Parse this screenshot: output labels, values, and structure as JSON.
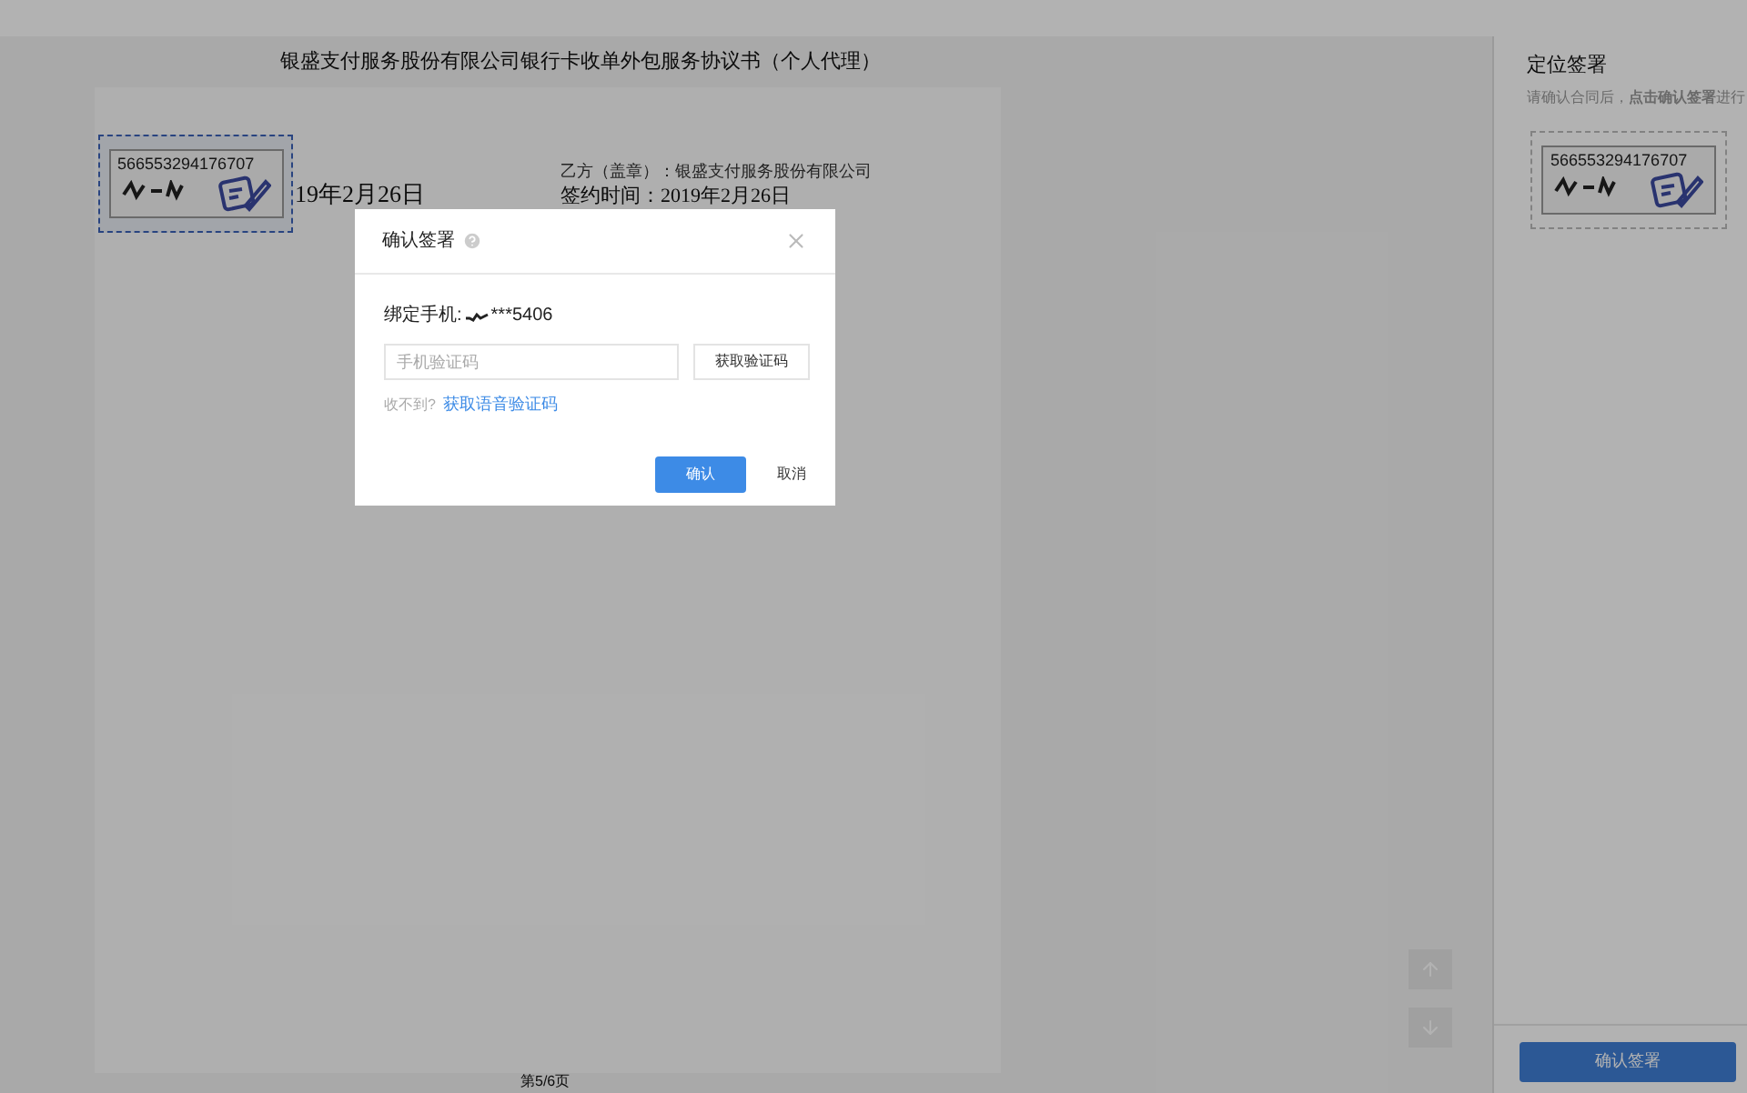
{
  "document": {
    "title": "银盛支付服务股份有限公司银行卡收单外包服务协议书（个人代理）",
    "left_date": "19年2月26日",
    "party_b": "乙方（盖章）：银盛支付服务股份有限公司",
    "sign_time": "签约时间：2019年2月26日",
    "stamp": {
      "number": "566553294176707"
    },
    "page_label": "第5/6页"
  },
  "right_panel": {
    "title": "定位签署",
    "hint": "请确认合同后，**点击确认签署**进行",
    "stamp": {
      "number": "566553294176707"
    },
    "button": "确认签署"
  },
  "dialog": {
    "title": "确认签署",
    "phone_label": "绑定手机:",
    "phone": "***5406",
    "code_field": {
      "placeholder": "手机验证码"
    },
    "get_code": "获取验证码",
    "no_code": "收不到?",
    "voice_code": "获取语音验证码",
    "confirm": "确认",
    "cancel": "取消"
  }
}
